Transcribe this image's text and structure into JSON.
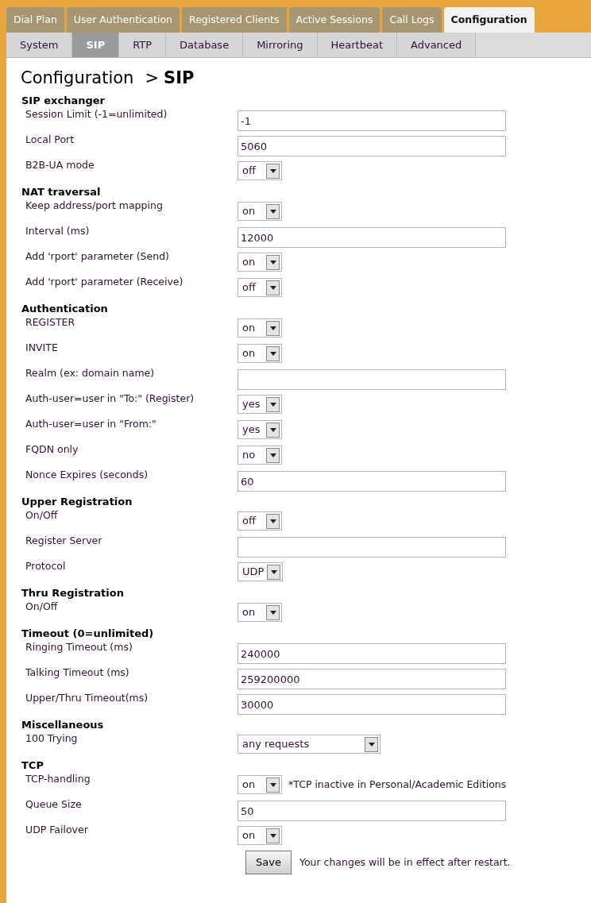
{
  "tabs": [
    {
      "label": "Dial Plan",
      "selected": false
    },
    {
      "label": "User Authentication",
      "selected": false
    },
    {
      "label": "Registered Clients",
      "selected": false
    },
    {
      "label": "Active Sessions",
      "selected": false
    },
    {
      "label": "Call Logs",
      "selected": false
    },
    {
      "label": "Configuration",
      "selected": true
    }
  ],
  "subtabs": [
    {
      "label": "System",
      "selected": false
    },
    {
      "label": "SIP",
      "selected": true
    },
    {
      "label": "RTP",
      "selected": false
    },
    {
      "label": "Database",
      "selected": false
    },
    {
      "label": "Mirroring",
      "selected": false
    },
    {
      "label": "Heartbeat",
      "selected": false
    },
    {
      "label": "Advanced",
      "selected": false
    }
  ],
  "breadcrumb": {
    "parent": "Configuration",
    "separator": ">",
    "current": "SIP"
  },
  "sections": [
    {
      "title": "SIP exchanger",
      "rows": [
        {
          "label": "Session Limit (-1=unlimited)",
          "kind": "text",
          "value": "-1"
        },
        {
          "label": "Local Port",
          "kind": "text",
          "value": "5060"
        },
        {
          "label": "B2B-UA mode",
          "kind": "select",
          "value": "off"
        }
      ]
    },
    {
      "title": "NAT traversal",
      "rows": [
        {
          "label": "Keep address/port mapping",
          "kind": "select",
          "value": "on"
        },
        {
          "label": "Interval (ms)",
          "kind": "text",
          "value": "12000"
        },
        {
          "label": "Add 'rport' parameter (Send)",
          "kind": "select",
          "value": "on"
        },
        {
          "label": "Add 'rport' parameter (Receive)",
          "kind": "select",
          "value": "off"
        }
      ]
    },
    {
      "title": "Authentication",
      "rows": [
        {
          "label": "REGISTER",
          "kind": "select",
          "value": "on"
        },
        {
          "label": "INVITE",
          "kind": "select",
          "value": "on"
        },
        {
          "label": "Realm (ex: domain name)",
          "kind": "text"
        },
        {
          "label": "Auth-user=user in \"To:\" (Register)",
          "kind": "select",
          "value": "yes"
        },
        {
          "label": "Auth-user=user in \"From:\"",
          "kind": "select",
          "value": "yes"
        },
        {
          "label": "FQDN only",
          "kind": "select",
          "value": "no"
        },
        {
          "label": "Nonce Expires (seconds)",
          "kind": "text",
          "value": "60"
        }
      ]
    },
    {
      "title": "Upper Registration",
      "rows": [
        {
          "label": "On/Off",
          "kind": "select",
          "value": "off"
        },
        {
          "label": "Register Server",
          "kind": "text"
        },
        {
          "label": "Protocol",
          "kind": "select",
          "value": "UDP"
        }
      ]
    },
    {
      "title": "Thru Registration",
      "rows": [
        {
          "label": "On/Off",
          "kind": "select",
          "value": "on"
        }
      ]
    },
    {
      "title": "Timeout (0=unlimited)",
      "rows": [
        {
          "label": "Ringing Timeout (ms)",
          "kind": "text",
          "value": "240000"
        },
        {
          "label": "Talking Timeout (ms)",
          "kind": "text",
          "value": "259200000"
        },
        {
          "label": "Upper/Thru Timeout(ms)",
          "kind": "text",
          "value": "30000"
        }
      ]
    },
    {
      "title": "Miscellaneous",
      "rows": [
        {
          "label": "100 Trying",
          "kind": "wideselect",
          "value": "any requests"
        }
      ]
    },
    {
      "title": "TCP",
      "rows": [
        {
          "label": "TCP-handling",
          "kind": "select",
          "value": "on",
          "note": "*TCP inactive in Personal/Academic Editions"
        },
        {
          "label": "Queue Size",
          "kind": "text",
          "value": "50"
        },
        {
          "label": "UDP Failover",
          "kind": "select",
          "value": "on"
        }
      ]
    }
  ],
  "save": {
    "label": "Save",
    "note": "Your changes will be in effect after restart."
  }
}
